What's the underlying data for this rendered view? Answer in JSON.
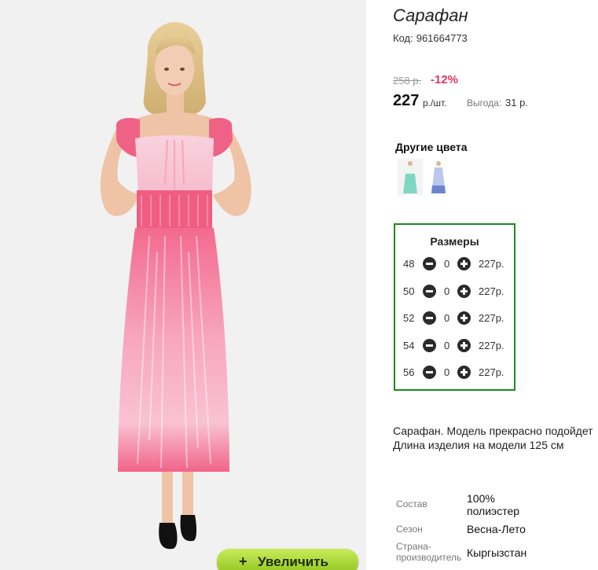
{
  "product": {
    "title": "Сарафан",
    "code_label": "Код:",
    "code_value": "961664773"
  },
  "pricing": {
    "old_price": "258 р.",
    "discount": "-12%",
    "price": "227",
    "price_unit": "р./шт.",
    "saving_label": "Выгода:",
    "saving_value": "31 р."
  },
  "other_colors": {
    "title": "Другие цвета",
    "swatches": [
      {
        "color_top": "#4fb8a8",
        "color_bottom": "#7fd6c2"
      },
      {
        "color_top": "#dfe6f6",
        "color_bottom": "#6a86cf"
      }
    ]
  },
  "sizes": {
    "title": "Размеры",
    "rows": [
      {
        "size": "48",
        "qty": "0",
        "price": "227р."
      },
      {
        "size": "50",
        "qty": "0",
        "price": "227р."
      },
      {
        "size": "52",
        "qty": "0",
        "price": "227р."
      },
      {
        "size": "54",
        "qty": "0",
        "price": "227р."
      },
      {
        "size": "56",
        "qty": "0",
        "price": "227р."
      }
    ]
  },
  "description": {
    "line1": "Сарафан. Модель прекрасно подойдет",
    "line2": "Длина изделия на модели 125 см"
  },
  "specs": [
    {
      "label": "Состав",
      "value": "100% полиэстер"
    },
    {
      "label": "Сезон",
      "value": "Весна-Лето"
    },
    {
      "label": "Страна-производитель",
      "value": "Кыргызстан"
    }
  ],
  "zoom": {
    "icon": "+",
    "label": "Увеличить"
  },
  "colors": {
    "frame_green": "#1d8a1d",
    "discount_red": "#e0375e",
    "button_green": "#a6d636",
    "dress_pink": "#f06a8e"
  }
}
